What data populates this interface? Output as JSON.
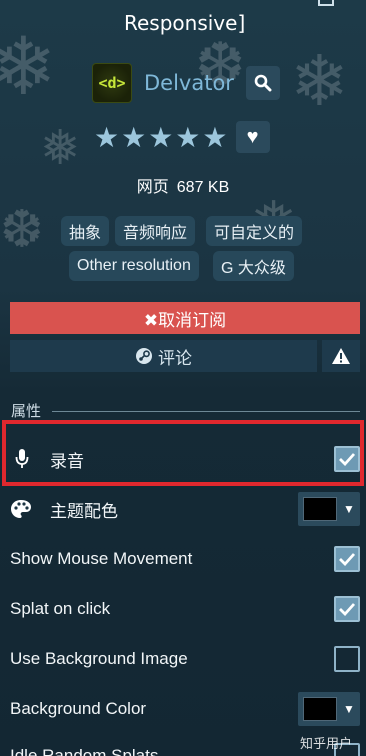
{
  "header": {
    "title": "Responsive]"
  },
  "app": {
    "logo_text": "<d>",
    "name": "Delvator"
  },
  "rating": {
    "stars_text": "★★★★★",
    "stars": 5
  },
  "meta": {
    "type_label": "网页",
    "size": "687 KB"
  },
  "tags": [
    "抽象",
    "音频响应",
    "可自定义的",
    "Other resolution",
    "G 大众级"
  ],
  "actions": {
    "unsubscribe_label": "✖取消订阅",
    "comment_label": "评论"
  },
  "properties": {
    "section_label": "属性",
    "items": [
      {
        "label": "录音",
        "control": "checkbox",
        "checked": true,
        "icon": "microphone-icon"
      },
      {
        "label": "主题配色",
        "control": "color",
        "value": "#000000",
        "icon": "palette-icon"
      },
      {
        "label": "Show Mouse Movement",
        "control": "checkbox",
        "checked": true
      },
      {
        "label": "Splat on click",
        "control": "checkbox",
        "checked": true
      },
      {
        "label": "Use Background Image",
        "control": "checkbox",
        "checked": false
      },
      {
        "label": "Background Color",
        "control": "color",
        "value": "#000000"
      },
      {
        "label": "Idle Random Splats",
        "control": "checkbox",
        "checked": false
      }
    ]
  },
  "colors": {
    "unsubscribe_bg": "#d9534f",
    "highlight_border": "#e0282e",
    "checkbox_checked": "#6e9ab4"
  },
  "watermark": "知乎用户"
}
